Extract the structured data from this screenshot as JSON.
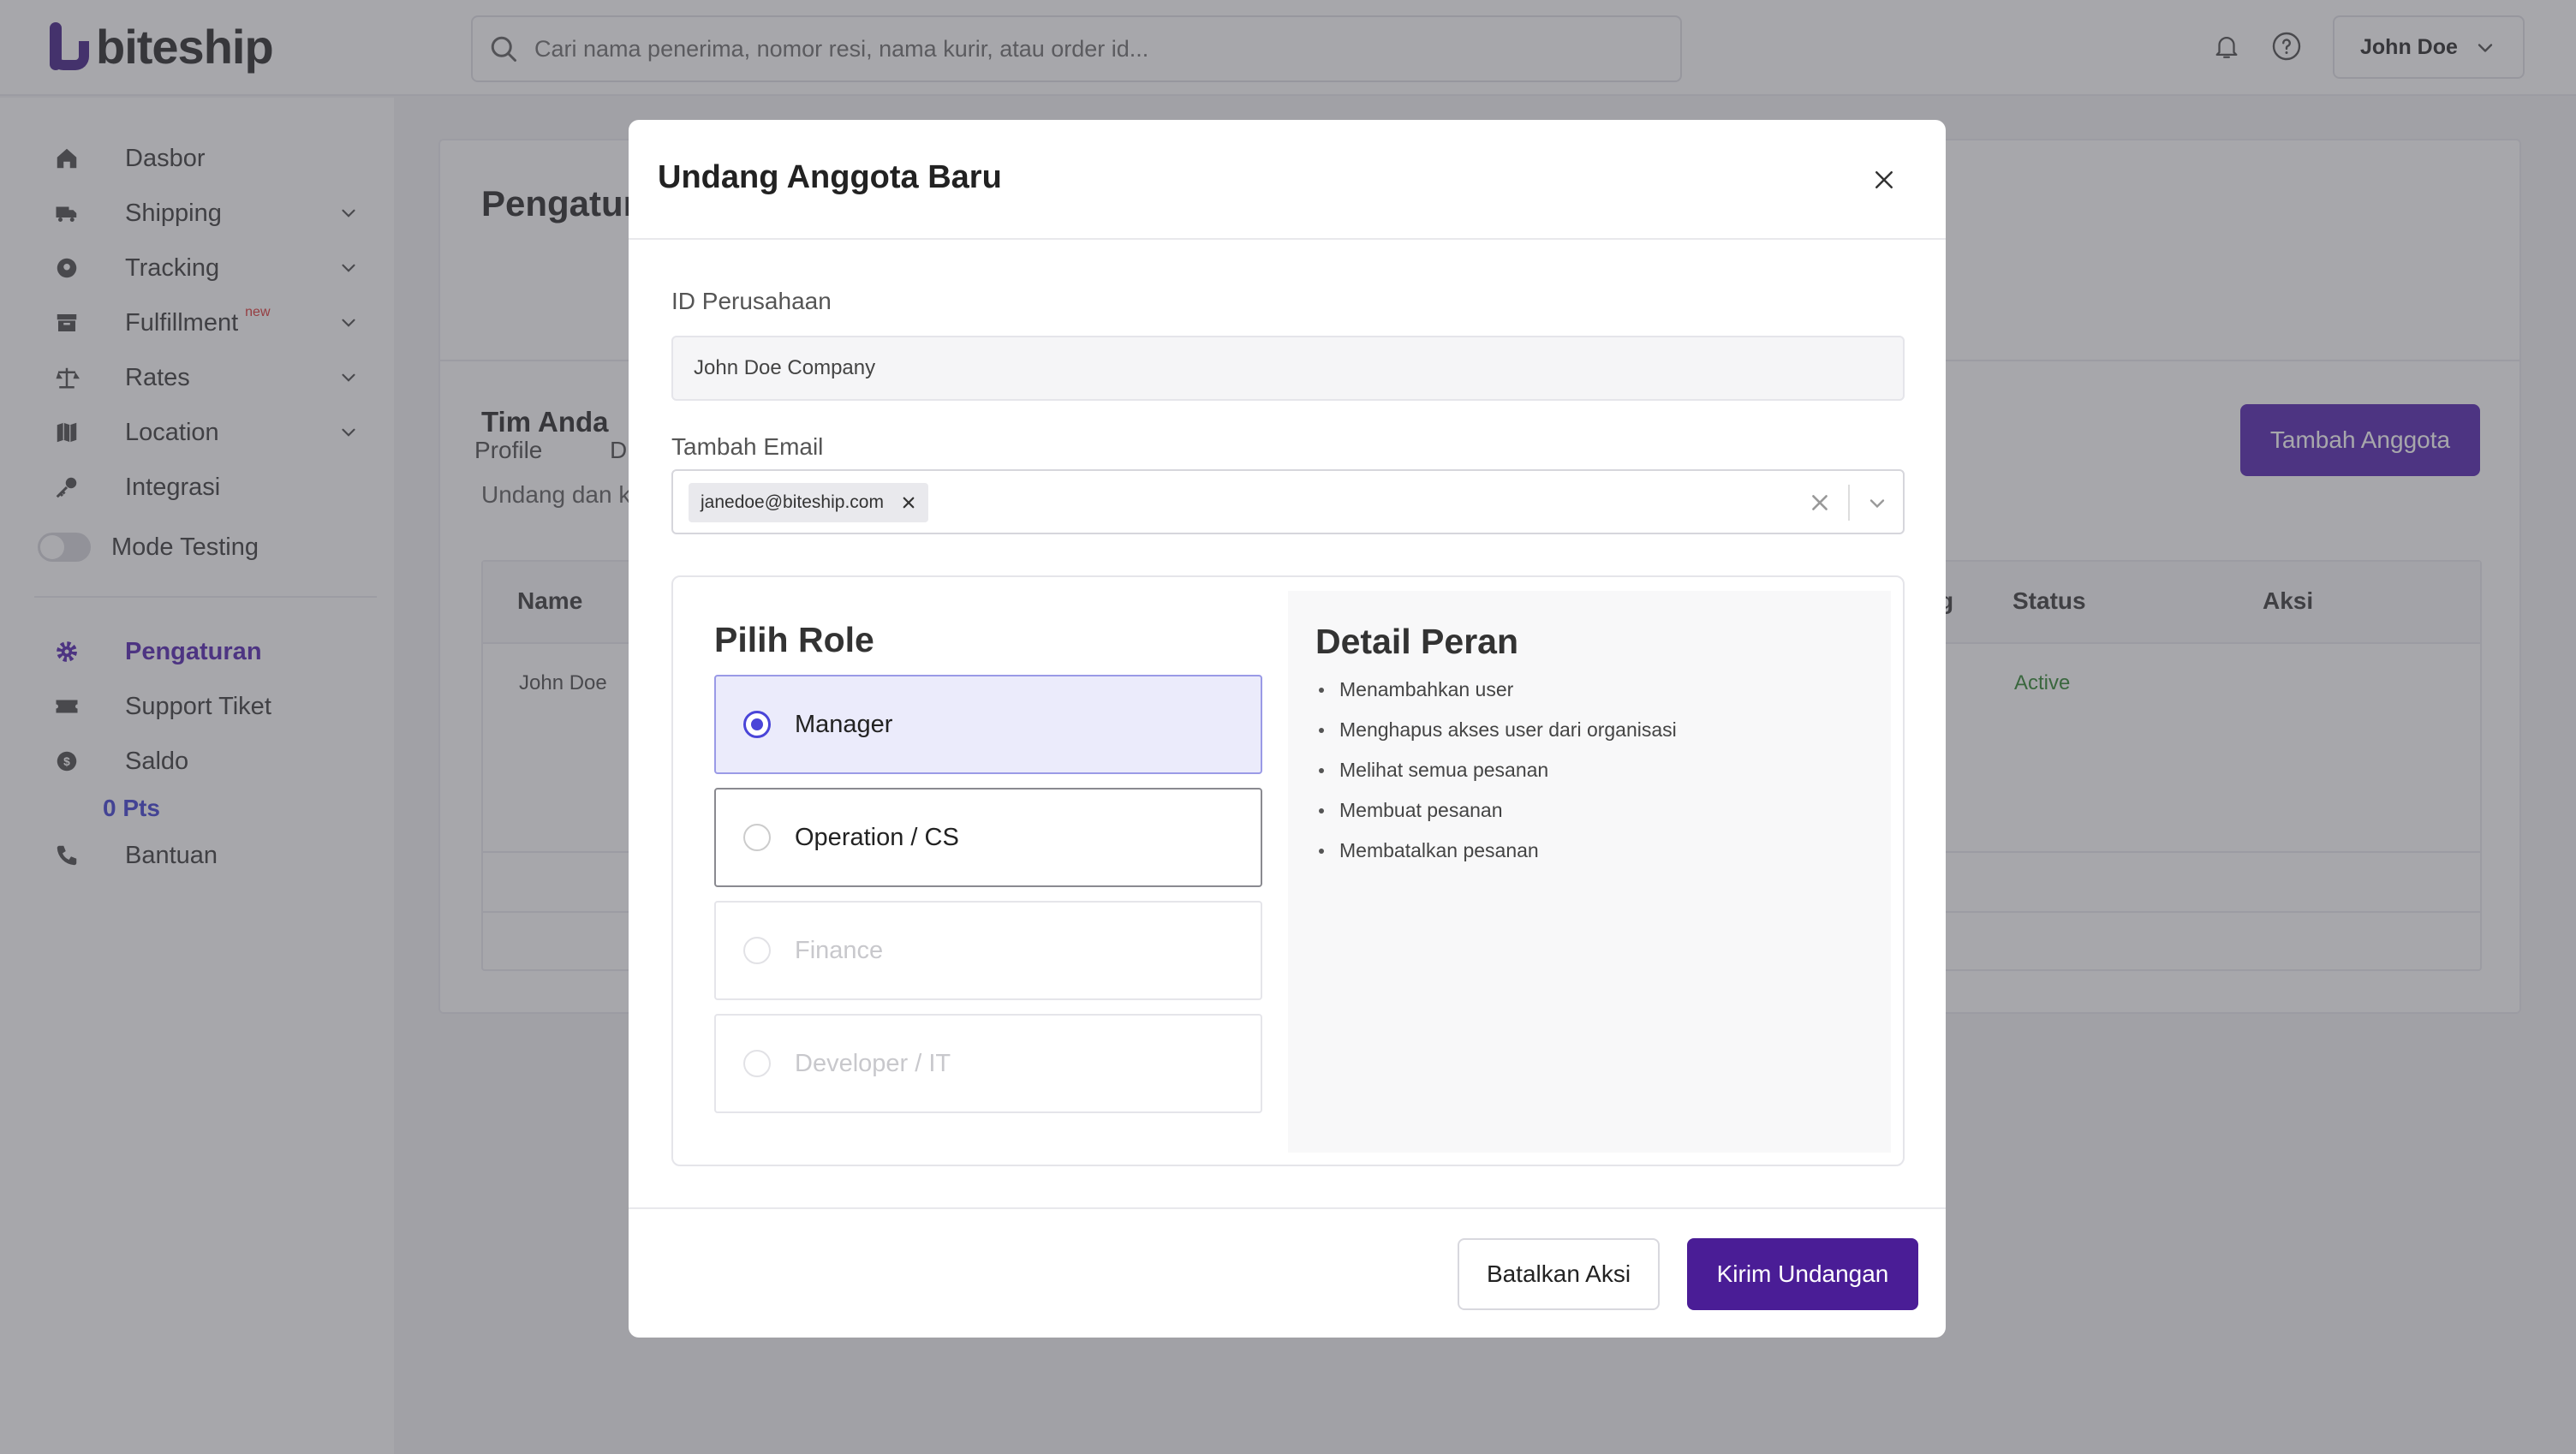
{
  "app": {
    "logo_text": "biteship"
  },
  "search": {
    "placeholder": "Cari nama penerima, nomor resi, nama kurir, atau order id..."
  },
  "header": {
    "user_name": "John Doe"
  },
  "sidebar": {
    "items": [
      {
        "label": "Dasbor",
        "icon": "home-icon"
      },
      {
        "label": "Shipping",
        "icon": "truck-icon"
      },
      {
        "label": "Tracking",
        "icon": "tracking-icon"
      },
      {
        "label": "Fulfillment",
        "icon": "box-icon",
        "badge": "new"
      },
      {
        "label": "Rates",
        "icon": "scale-icon"
      },
      {
        "label": "Location",
        "icon": "map-icon"
      },
      {
        "label": "Integrasi",
        "icon": "key-icon"
      },
      {
        "label": "Mode Testing",
        "icon": "toggle"
      },
      {
        "label": "Pengaturan",
        "icon": "gear-icon"
      },
      {
        "label": "Support Tiket",
        "icon": "ticket-icon"
      },
      {
        "label": "Saldo",
        "icon": "coin-icon"
      },
      {
        "label": "Bantuan",
        "icon": "phone-icon"
      }
    ],
    "points": "0 Pts"
  },
  "page": {
    "title": "Pengatur",
    "tabs": [
      "Profile",
      "D"
    ],
    "team_title": "Tim Anda",
    "team_subtitle": "Undang dan k",
    "add_button": "Tambah Anggota",
    "table": {
      "headers": {
        "name": "Name",
        "g": "g",
        "status": "Status",
        "action": "Aksi"
      },
      "row": {
        "name": "John Doe",
        "status": "Active"
      }
    }
  },
  "modal": {
    "title": "Undang Anggota Baru",
    "company_label": "ID Perusahaan",
    "company_value": "John Doe Company",
    "email_label": "Tambah Email",
    "email_chip": "janedoe@biteship.com",
    "role_title": "Pilih Role",
    "roles": [
      {
        "label": "Manager",
        "state": "selected"
      },
      {
        "label": "Operation / CS",
        "state": "available"
      },
      {
        "label": "Finance",
        "state": "disabled"
      },
      {
        "label": "Developer / IT",
        "state": "disabled"
      }
    ],
    "detail_title": "Detail Peran",
    "details": [
      "Menambahkan user",
      "Menghapus akses user dari organisasi",
      "Melihat semua pesanan",
      "Membuat pesanan",
      "Membatalkan pesanan"
    ],
    "cancel_label": "Batalkan Aksi",
    "submit_label": "Kirim Undangan"
  },
  "colors": {
    "brand": "#4b2a8c",
    "primary_button": "#4a1d96",
    "radio_selected": "#4a45d8",
    "selected_bg": "#ebebfb",
    "overlay": "rgba(60,60,68,0.45)"
  }
}
